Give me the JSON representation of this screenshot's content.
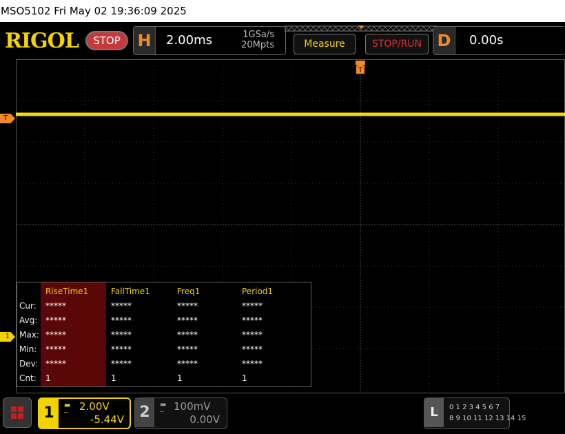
{
  "titlebar": {
    "text": "MSO5102  Fri May 02 19:36:09 2025"
  },
  "top": {
    "logo": "RIGOL",
    "run_state": "STOP",
    "horizontal": {
      "letter": "H",
      "timebase": "2.00ms",
      "sample_rate": "1GSa/s",
      "memory_depth": "20Mpts"
    },
    "measure_button": "Measure",
    "stoprun_button": "STOP/RUN",
    "delay": {
      "letter": "D",
      "value": "0.00s"
    }
  },
  "markers": {
    "trigger_top": "T",
    "trigger_level": "T",
    "ch1": "1"
  },
  "measurements": {
    "headers": [
      "RiseTime1",
      "FallTime1",
      "Freq1",
      "Period1"
    ],
    "rows": [
      {
        "label": "Cur:",
        "values": [
          "*****",
          "*****",
          "*****",
          "*****"
        ]
      },
      {
        "label": "Avg:",
        "values": [
          "*****",
          "*****",
          "*****",
          "*****"
        ]
      },
      {
        "label": "Max:",
        "values": [
          "*****",
          "*****",
          "*****",
          "*****"
        ]
      },
      {
        "label": "Min:",
        "values": [
          "*****",
          "*****",
          "*****",
          "*****"
        ]
      },
      {
        "label": "Dev:",
        "values": [
          "*****",
          "*****",
          "*****",
          "*****"
        ]
      },
      {
        "label": "Cnt:",
        "values": [
          "1",
          "1",
          "1",
          "1"
        ]
      }
    ]
  },
  "channels": {
    "ch1": {
      "number": "1",
      "coupling": "DC",
      "scale": "2.00V",
      "offset": "-5.44V",
      "color": "#f2d300"
    },
    "ch2": {
      "number": "2",
      "coupling": "DC",
      "scale": "100mV",
      "offset": "0.00V",
      "color": "#999999"
    }
  },
  "la": {
    "letter": "L",
    "row1": "0 1 2 3  4 5 6 7",
    "row2": "8 9 10 11 12 13 14 15"
  },
  "colors": {
    "trace": "#f2d300",
    "accent": "#f08a28",
    "stop": "#c23a3a",
    "highlight": "#5a0707"
  }
}
